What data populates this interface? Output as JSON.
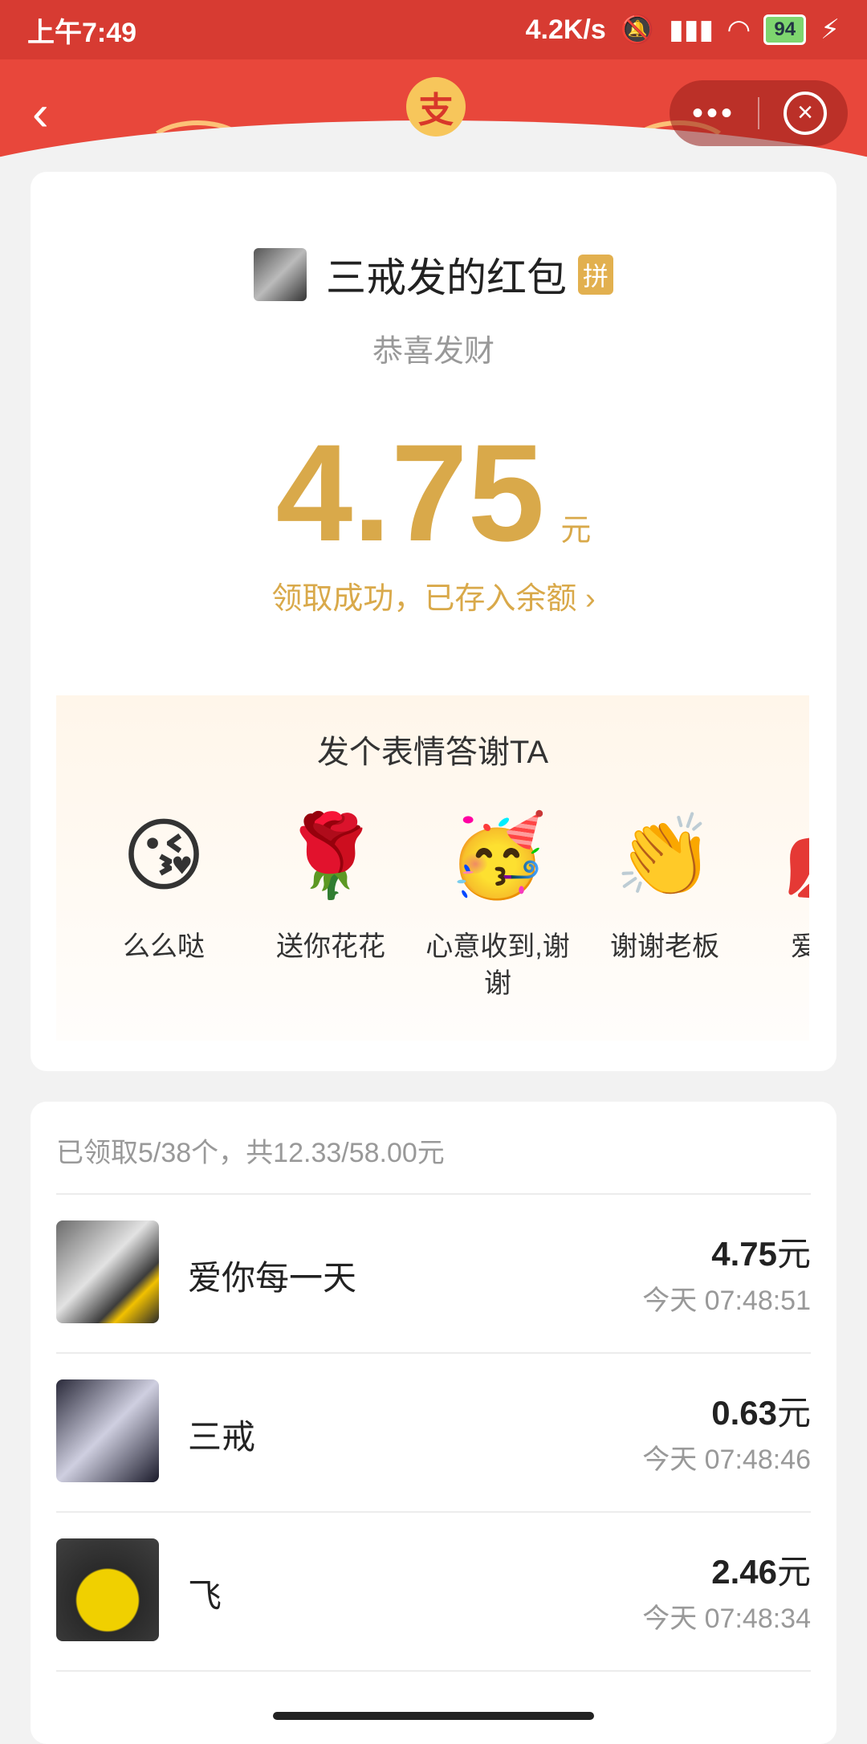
{
  "status_bar": {
    "time": "上午7:49",
    "speed": "4.2K/s",
    "icons": [
      "bell-off-icon",
      "hd-signal-icon",
      "wifi-icon"
    ],
    "battery": "94"
  },
  "header": {
    "back_icon": "‹",
    "logo_char": "支",
    "more_icon": "•••",
    "close_icon": "×"
  },
  "packet": {
    "title": "三戒发的红包",
    "badge": "拼",
    "subtitle": "恭喜发财",
    "amount": "4.75",
    "unit": "元",
    "status_link": "领取成功，已存入余额 ›"
  },
  "thanks": {
    "title": "发个表情答谢TA",
    "items": [
      {
        "emoji": "😘",
        "label": "么么哒"
      },
      {
        "emoji": "🌹",
        "label": "送你花花"
      },
      {
        "emoji": "🥳",
        "label": "心意收到,谢谢"
      },
      {
        "emoji": "👏",
        "label": "谢谢老板"
      },
      {
        "emoji": "💋",
        "label": "爱你么"
      }
    ]
  },
  "list": {
    "summary": "已领取5/38个，共12.33/58.00元",
    "unit": "元",
    "rows": [
      {
        "name": "爱你每一天",
        "amount": "4.75",
        "time": "今天 07:48:51"
      },
      {
        "name": "三戒",
        "amount": "0.63",
        "time": "今天 07:48:46"
      },
      {
        "name": "飞",
        "amount": "2.46",
        "time": "今天 07:48:34"
      }
    ]
  }
}
